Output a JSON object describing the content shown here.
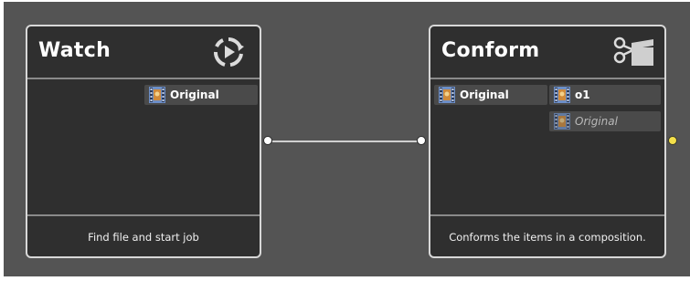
{
  "nodes": {
    "watch": {
      "title": "Watch",
      "icon": "refresh-play-icon",
      "outputs": [
        "Original"
      ],
      "description": "Find file and start job"
    },
    "conform": {
      "title": "Conform",
      "icon": "scissors-clapper-icon",
      "inputs": [
        "Original"
      ],
      "outputs": [
        "o1",
        "Original"
      ],
      "description": "Conforms the items in a composition."
    }
  },
  "colors": {
    "canvas": "#545454",
    "node_bg": "#2f2f2f",
    "node_border": "#d8d8d8",
    "chip_bg": "#4a4a4a",
    "active_port": "#f4e04a"
  }
}
